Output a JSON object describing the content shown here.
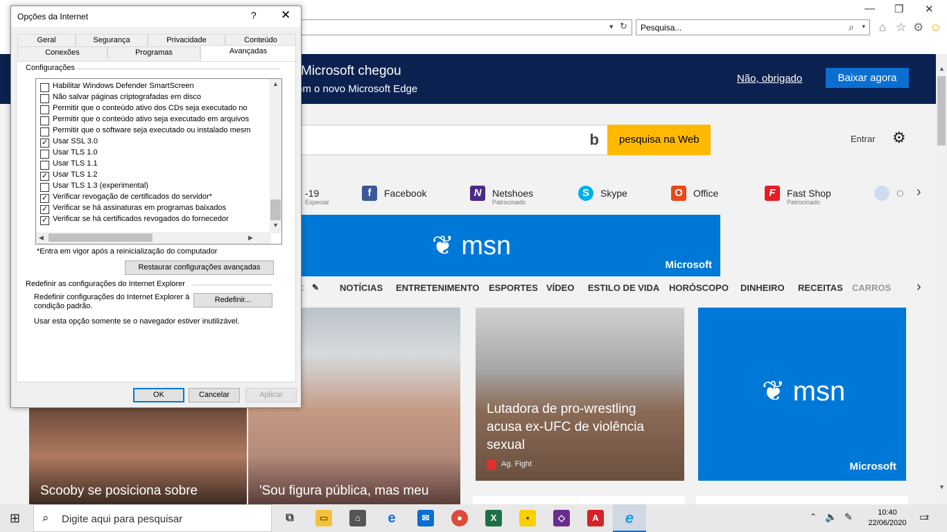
{
  "browser": {
    "search_placeholder": "Pesquisa...",
    "icons": [
      "refresh-icon",
      "search-icon",
      "home-icon",
      "favorites-icon",
      "settings-icon",
      "smiley-icon"
    ]
  },
  "msn": {
    "banner": {
      "title": "Microsoft chegou",
      "subtitle": "om o novo Microsoft Edge",
      "decline": "Não, obrigado",
      "download": "Baixar agora"
    },
    "search_button": "pesquisa na Web",
    "signin": "Entrar",
    "quicklinks": [
      {
        "label": "-19",
        "sub": "Especial"
      },
      {
        "label": "Facebook",
        "sub": ""
      },
      {
        "label": "Netshoes",
        "sub": "Patrocinado"
      },
      {
        "label": "Skype",
        "sub": ""
      },
      {
        "label": "Office",
        "sub": ""
      },
      {
        "label": "Fast Shop",
        "sub": "Patrocinado"
      },
      {
        "label": "O",
        "sub": ""
      }
    ],
    "ad_logo": "msn",
    "ad_brand": "Microsoft",
    "nav": [
      "C",
      "NOTÍCIAS",
      "ENTRETENIMENTO",
      "ESPORTES",
      "VÍDEO",
      "ESTILO DE VIDA",
      "HORÓSCOPO",
      "DINHEIRO",
      "RECEITAS",
      "CARROS"
    ],
    "cards": {
      "wrestler_caption": "Lutadora de pro-wrestling acusa ex-UFC de violência sexual",
      "wrestler_source": "Ag. Fight",
      "scooby_caption": "Scooby se posiciona sobre",
      "girl_caption": "'Sou figura pública, mas meu",
      "tile_logo": "msn",
      "tile_brand": "Microsoft"
    }
  },
  "dialog": {
    "title": "Opções da Internet",
    "help": "?",
    "close": "✕",
    "tabs_row1": [
      "Geral",
      "Segurança",
      "Privacidade",
      "Conteúdo"
    ],
    "tabs_row2": [
      "Conexões",
      "Programas",
      "Avançadas"
    ],
    "settings_group": "Configurações",
    "items": [
      {
        "label": "Habilitar Windows Defender SmartScreen",
        "checked": false
      },
      {
        "label": "Não salvar páginas criptografadas em disco",
        "checked": false
      },
      {
        "label": "Permitir que o conteúdo ativo dos CDs seja executado no",
        "checked": false
      },
      {
        "label": "Permitir que o conteúdo ativo seja executado em arquivos",
        "checked": false
      },
      {
        "label": "Permitir que o software seja executado ou instalado mesm",
        "checked": false
      },
      {
        "label": "Usar SSL 3.0",
        "checked": true
      },
      {
        "label": "Usar TLS 1.0",
        "checked": false
      },
      {
        "label": "Usar TLS 1.1",
        "checked": false
      },
      {
        "label": "Usar TLS 1.2",
        "checked": true
      },
      {
        "label": "Usar TLS 1.3 (experimental)",
        "checked": false
      },
      {
        "label": "Verificar revogação de certificados do servidor*",
        "checked": true
      },
      {
        "label": "Verificar se há assinaturas em programas baixados",
        "checked": true
      },
      {
        "label": "Verificar se há certificados revogados do fornecedor",
        "checked": true
      }
    ],
    "restart_note": "*Entra em vigor após a reinicialização do computador",
    "restore_button": "Restaurar configurações avançadas",
    "reset_group": "Redefinir as configurações do Internet Explorer",
    "reset_text": "Redefinir configurações do Internet Explorer à condição padrão.",
    "reset_button": "Redefinir...",
    "reset_note": "Usar esta opção somente se o navegador estiver inutilizável.",
    "ok": "OK",
    "cancel": "Cancelar",
    "apply": "Aplicar"
  },
  "taskbar": {
    "search_placeholder": "Digite aqui para pesquisar",
    "time": "10:40",
    "date": "22/06/2020",
    "notifications": "2"
  }
}
